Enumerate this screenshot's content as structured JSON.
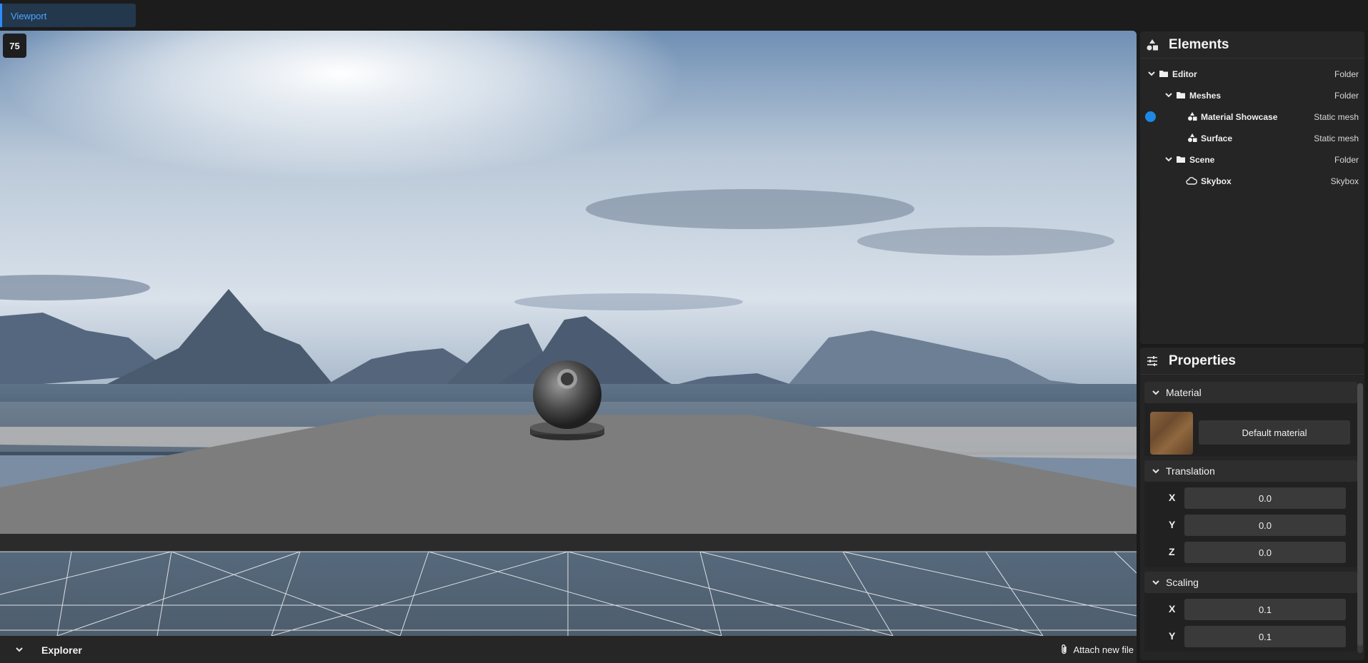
{
  "topbar": {
    "tab_label": "Viewport"
  },
  "viewport": {
    "fps": "75"
  },
  "bottombar": {
    "explorer_label": "Explorer",
    "attach_label": "Attach new file"
  },
  "elements": {
    "title": "Elements",
    "tree": [
      {
        "label": "Editor",
        "type": "Folder",
        "icon": "folder-icon",
        "expanded": true
      },
      {
        "label": "Meshes",
        "type": "Folder",
        "icon": "folder-icon",
        "expanded": true
      },
      {
        "label": "Material Showcase",
        "type": "Static mesh",
        "icon": "mesh-icon",
        "selected": true
      },
      {
        "label": "Surface",
        "type": "Static mesh",
        "icon": "mesh-icon"
      },
      {
        "label": "Scene",
        "type": "Folder",
        "icon": "folder-icon",
        "expanded": true
      },
      {
        "label": "Skybox",
        "type": "Skybox",
        "icon": "cloud-icon"
      }
    ]
  },
  "properties": {
    "title": "Properties",
    "material": {
      "title": "Material",
      "button": "Default material"
    },
    "translation": {
      "title": "Translation",
      "x_label": "X",
      "x": "0.0",
      "y_label": "Y",
      "y": "0.0",
      "z_label": "Z",
      "z": "0.0"
    },
    "scaling": {
      "title": "Scaling",
      "x_label": "X",
      "x": "0.1",
      "y_label": "Y",
      "y": "0.1"
    }
  },
  "colors": {
    "accent": "#2f8cff",
    "selection": "#1e88e5",
    "panel_bg": "#252525"
  }
}
